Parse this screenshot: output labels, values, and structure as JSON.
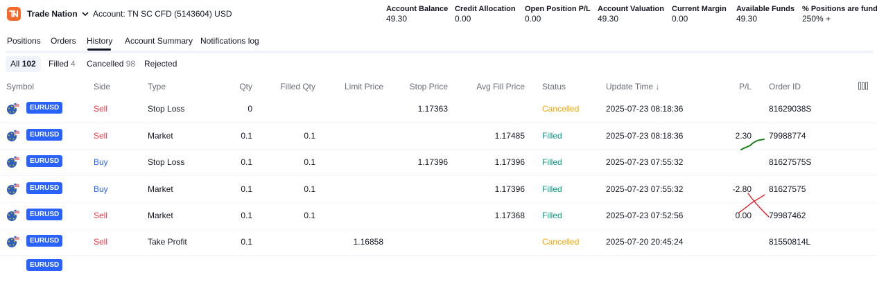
{
  "header": {
    "brand": "Trade Nation",
    "account": "Account: TN SC CFD (5143604) USD",
    "metrics": [
      {
        "label": "Account Balance",
        "value": "49.30"
      },
      {
        "label": "Credit Allocation",
        "value": "0.00"
      },
      {
        "label": "Open Position P/L",
        "value": "0.00"
      },
      {
        "label": "Account Valuation",
        "value": "49.30"
      },
      {
        "label": "Current Margin",
        "value": "0.00"
      },
      {
        "label": "Available Funds",
        "value": "49.30"
      },
      {
        "label": "% Positions are funded",
        "value": "250% +"
      }
    ]
  },
  "tabs": [
    {
      "label": "Positions"
    },
    {
      "label": "Orders"
    },
    {
      "label": "History",
      "active": true
    },
    {
      "label": "Account Summary"
    },
    {
      "label": "Notifications log"
    }
  ],
  "filters": [
    {
      "label": "All",
      "count": "102",
      "active": true
    },
    {
      "label": "Filled",
      "count": "4"
    },
    {
      "label": "Cancelled",
      "count": "98"
    },
    {
      "label": "Rejected",
      "count": ""
    }
  ],
  "table": {
    "columns": {
      "symbol": "Symbol",
      "side": "Side",
      "type": "Type",
      "qty": "Qty",
      "filled_qty": "Filled Qty",
      "limit_price": "Limit Price",
      "stop_price": "Stop Price",
      "avg_fill_price": "Avg Fill Price",
      "status": "Status",
      "update_time": "Update Time ↓",
      "pl": "P/L",
      "order_id": "Order ID"
    },
    "rows": [
      {
        "symbol": "EURUSD",
        "side": "Sell",
        "type": "Stop Loss",
        "qty": "0",
        "filled_qty": "",
        "limit_price": "",
        "stop_price": "1.17363",
        "avg_fill_price": "",
        "status": "Cancelled",
        "update_time": "2025-07-23 08:18:36",
        "pl": "",
        "order_id": "81629038S"
      },
      {
        "symbol": "EURUSD",
        "side": "Sell",
        "type": "Market",
        "qty": "0.1",
        "filled_qty": "0.1",
        "limit_price": "",
        "stop_price": "",
        "avg_fill_price": "1.17485",
        "status": "Filled",
        "update_time": "2025-07-23 08:18:36",
        "pl": "2.30",
        "order_id": "79988774"
      },
      {
        "symbol": "EURUSD",
        "side": "Buy",
        "type": "Stop Loss",
        "qty": "0.1",
        "filled_qty": "0.1",
        "limit_price": "",
        "stop_price": "1.17396",
        "avg_fill_price": "1.17396",
        "status": "Filled",
        "update_time": "2025-07-23 07:55:32",
        "pl": "",
        "order_id": "81627575S"
      },
      {
        "symbol": "EURUSD",
        "side": "Buy",
        "type": "Market",
        "qty": "0.1",
        "filled_qty": "0.1",
        "limit_price": "",
        "stop_price": "",
        "avg_fill_price": "1.17396",
        "status": "Filled",
        "update_time": "2025-07-23 07:55:32",
        "pl": "-2.80",
        "order_id": "81627575"
      },
      {
        "symbol": "EURUSD",
        "side": "Sell",
        "type": "Market",
        "qty": "0.1",
        "filled_qty": "0.1",
        "limit_price": "",
        "stop_price": "",
        "avg_fill_price": "1.17368",
        "status": "Filled",
        "update_time": "2025-07-23 07:52:56",
        "pl": "0.00",
        "order_id": "79987462"
      },
      {
        "symbol": "EURUSD",
        "side": "Sell",
        "type": "Take Profit",
        "qty": "0.1",
        "filled_qty": "",
        "limit_price": "1.16858",
        "stop_price": "",
        "avg_fill_price": "",
        "status": "Cancelled",
        "update_time": "2025-07-20 20:45:24",
        "pl": "",
        "order_id": "81550814L"
      }
    ]
  },
  "colors": {
    "brand": "#f56a28",
    "badge": "#2962ff",
    "sell": "#f23645",
    "buy": "#2962ff",
    "filled": "#089981",
    "cancelled": "#f7a600",
    "annotation_check": "#1a7f1a",
    "annotation_cross": "#e3121b"
  },
  "icons": {
    "logo": "trade-nation-logo-icon",
    "dropdown": "chevron-down-icon",
    "flag": "eur-usd-flag-icon",
    "settings": "column-settings-icon"
  }
}
